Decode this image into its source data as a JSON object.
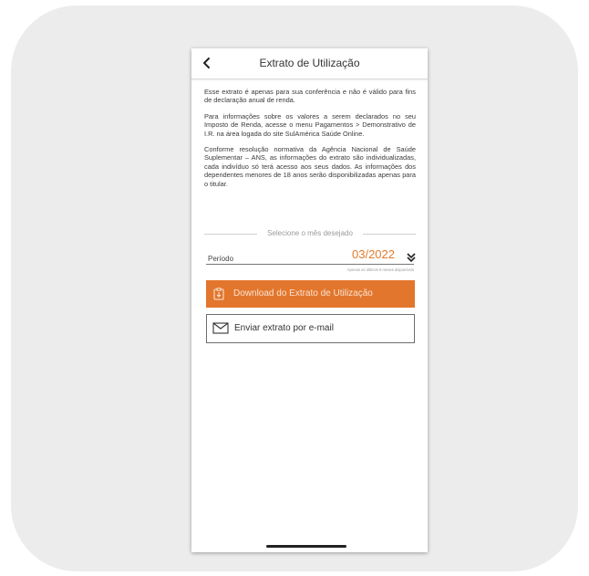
{
  "header": {
    "title": "Extrato de Utilização",
    "back_icon": "chevron-left-icon"
  },
  "content": {
    "paragraphs": [
      "Esse extrato é apenas para sua conferência e não é válido para fins de declaração anual de renda.",
      "Para informações sobre os valores a serem declarados no seu Imposto de Renda, acesse o menu Pagamentos > Demonstrativo de I.R. na área logada do site SulAmérica Saúde Online.",
      "Conforme resolução normativa da Agência Nacional de Saúde Suplementar – ANS, as informações do extrato são individualizadas, cada indivíduo só terá acesso aos seus dados. As informações dos dependentes menores de 18 anos serão disponibilizadas apenas para o titular."
    ]
  },
  "selector": {
    "divider_label": "Selecione o mês desejado",
    "period_label": "Período",
    "period_value": "03/2022",
    "hint": "Apenas os últimos 6 meses disponíveis",
    "chevron_icon": "double-chevron-down-icon"
  },
  "actions": {
    "download_label": "Download do Extrato de Utilização",
    "download_icon": "clipboard-download-icon",
    "email_label": "Enviar extrato por e-mail",
    "email_icon": "envelope-icon"
  },
  "colors": {
    "accent": "#e2762d",
    "period_value": "#e07b2b",
    "background_card": "#ececec"
  }
}
